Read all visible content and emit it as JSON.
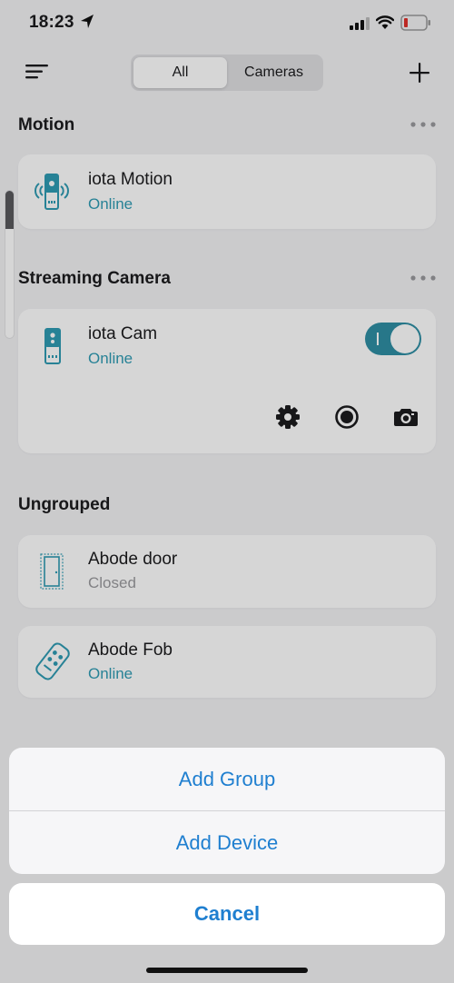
{
  "status_bar": {
    "time": "18:23"
  },
  "nav": {
    "menu_icon": "hamburger-icon",
    "tabs": [
      {
        "label": "All",
        "active": true
      },
      {
        "label": "Cameras",
        "active": false
      }
    ],
    "add_icon": "plus-icon"
  },
  "sections": {
    "motion": {
      "title": "Motion",
      "devices": [
        {
          "name": "iota Motion",
          "status": "Online",
          "icon": "motion-sensor-icon"
        }
      ]
    },
    "streaming": {
      "title": "Streaming Camera",
      "devices": [
        {
          "name": "iota Cam",
          "status": "Online",
          "icon": "camera-device-icon",
          "toggle_on": true
        }
      ],
      "actions": [
        "gear-icon",
        "record-icon",
        "camera-snapshot-icon"
      ]
    },
    "ungrouped": {
      "title": "Ungrouped",
      "devices": [
        {
          "name": "Abode door",
          "status": "Closed",
          "icon": "door-sensor-icon"
        },
        {
          "name": "Abode Fob",
          "status": "Online",
          "icon": "key-fob-icon"
        }
      ]
    }
  },
  "action_sheet": {
    "options": [
      "Add Group",
      "Add Device"
    ],
    "cancel": "Cancel"
  },
  "colors": {
    "accent": "#2f9bb3",
    "action_blue": "#1f7fd0",
    "toggle_on": "#2f8ea4"
  }
}
